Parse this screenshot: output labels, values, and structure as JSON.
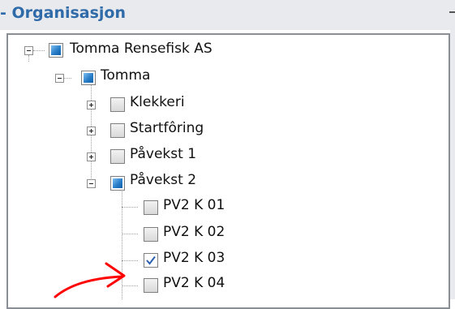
{
  "panel": {
    "title": "- Organisasjon"
  },
  "tree": {
    "root": {
      "label": "Tomma Rensefisk AS",
      "expanded": true,
      "state": "partial"
    },
    "site": {
      "label": "Tomma",
      "expanded": true,
      "state": "partial"
    },
    "units": [
      {
        "label": "Klekkeri",
        "expanded": false,
        "state": "unchecked"
      },
      {
        "label": "Startfôring",
        "expanded": false,
        "state": "unchecked"
      },
      {
        "label": "Påvekst 1",
        "expanded": false,
        "state": "unchecked"
      },
      {
        "label": "Påvekst 2",
        "expanded": true,
        "state": "partial"
      }
    ],
    "tanks": [
      {
        "label": "PV2 K 01",
        "state": "unchecked"
      },
      {
        "label": "PV2 K 02",
        "state": "unchecked"
      },
      {
        "label": "PV2 K 03",
        "state": "checked"
      },
      {
        "label": "PV2 K 04",
        "state": "unchecked"
      }
    ]
  },
  "colors": {
    "title": "#2f6aa9",
    "header_bg": "#e8eaee",
    "annotation": "#ff0000"
  },
  "icons": {
    "expand": "plus-box",
    "collapse": "minus-box",
    "check": "checkmark"
  }
}
